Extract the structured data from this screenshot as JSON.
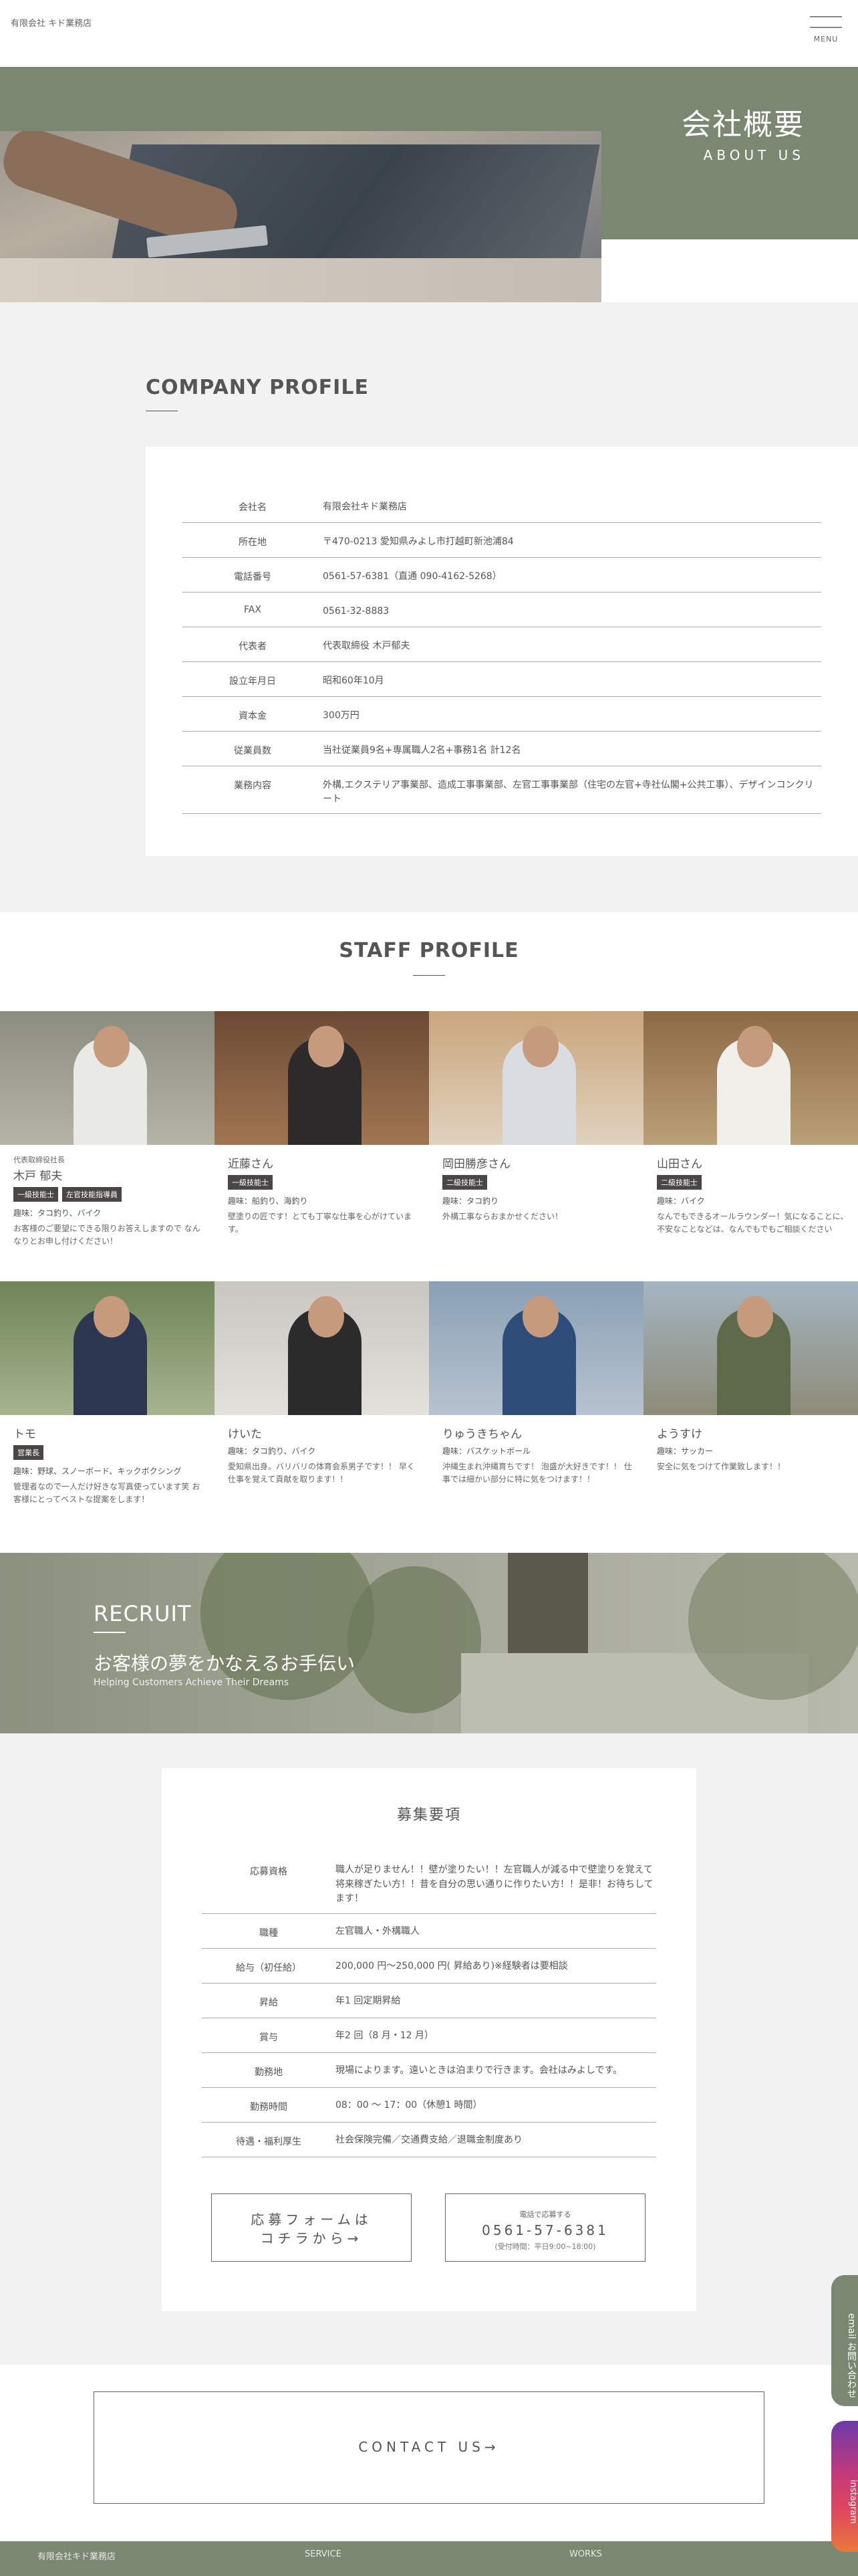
{
  "header": {
    "logo": "有限会社 キド業務店",
    "menu_label": "MENU"
  },
  "hero": {
    "title_jp": "会社概要",
    "title_en": "ABOUT US"
  },
  "company": {
    "heading": "COMPANY PROFILE",
    "rows": [
      {
        "k": "会社名",
        "v": "有限会社キド業務店"
      },
      {
        "k": "所在地",
        "v": "〒470-0213 愛知県みよし市打越町新池浦84"
      },
      {
        "k": "電話番号",
        "v": "0561-57-6381（直通 090-4162-5268）"
      },
      {
        "k": "FAX",
        "v": "0561-32-8883"
      },
      {
        "k": "代表者",
        "v": "代表取締役 木戸郁夫"
      },
      {
        "k": "設立年月日",
        "v": "昭和60年10月"
      },
      {
        "k": "資本金",
        "v": "300万円"
      },
      {
        "k": "従業員数",
        "v": "当社従業員9名+専属職人2名+事務1名 計12名"
      },
      {
        "k": "業務内容",
        "v": "外構,エクステリア事業部、造成工事事業部、左官工事事業部（住宅の左官+寺社仏閣+公共工事）、デザインコンクリート"
      }
    ]
  },
  "staff": {
    "heading": "STAFF PROFILE",
    "members": [
      {
        "title": "代表取締役社長",
        "name": "木戸 郁夫",
        "badges": [
          "一級技能士",
          "左官技能指導員"
        ],
        "hobby": "趣味：タコ釣り、バイク",
        "msg": "お客様のご要望にできる限りお答えしますので なんなりとお申し付けください！"
      },
      {
        "title": "",
        "name": "近藤さん",
        "badges": [
          "一級技能士"
        ],
        "hobby": "趣味：船釣り、海釣り",
        "msg": "壁塗りの匠です！とても丁寧な仕事を心がけています。"
      },
      {
        "title": "",
        "name": "岡田勝彦さん",
        "badges": [
          "二級技能士"
        ],
        "hobby": "趣味：タコ釣り",
        "msg": "外構工事ならおまかせください！"
      },
      {
        "title": "",
        "name": "山田さん",
        "badges": [
          "二級技能士"
        ],
        "hobby": "趣味：バイク",
        "msg": "なんでもできるオールラウンダー！気になることに、不安なことなどは、なんでもでもご相談ください"
      },
      {
        "title": "",
        "name": "トモ",
        "badges": [
          "営業長"
        ],
        "hobby": "趣味：野球、スノーボード、キックボクシング",
        "msg": "管理者なので一人だけ好きな写真使っています笑 お客様にとってベストな提案をします！"
      },
      {
        "title": "",
        "name": "けいた",
        "badges": [],
        "hobby": "趣味：タコ釣り、バイク",
        "msg": "愛知県出身。バリバリの体育会系男子です！！ 早く仕事を覚えて貢献を取ります！！"
      },
      {
        "title": "",
        "name": "りゅうきちゃん",
        "badges": [],
        "hobby": "趣味：バスケットボール",
        "msg": "沖縄生まれ沖縄育ちです！ 泡盛が大好きです！！ 仕事では細かい部分に特に気をつけます！！"
      },
      {
        "title": "",
        "name": "ようすけ",
        "badges": [],
        "hobby": "趣味：サッカー",
        "msg": "安全に気をつけて作業致します！！"
      }
    ]
  },
  "recruit_banner": {
    "en": "RECRUIT",
    "jp": "お客様の夢をかなえるお手伝い",
    "sub": "Helping Customers Achieve Their Dreams"
  },
  "recruit": {
    "title": "募集要項",
    "rows": [
      {
        "k": "応募資格",
        "v": "職人が足りません！！壁が塗りたい！！左官職人が減る中で壁塗りを覚えて将来稼ぎたい方！！昔を自分の思い通りに作りたい方！！是非！お待ちしてます！"
      },
      {
        "k": "職種",
        "v": "左官職人・外構職人"
      },
      {
        "k": "給与（初任給）",
        "v": "200,000 円〜250,000 円( 昇給あり)※経験者は要相談"
      },
      {
        "k": "昇給",
        "v": "年1 回定期昇給"
      },
      {
        "k": "賞与",
        "v": "年2 回（8 月・12 月）"
      },
      {
        "k": "勤務地",
        "v": "現場によります。遠いときは泊まりで行きます。会社はみよしです。"
      },
      {
        "k": "勤務時間",
        "v": "08：00 〜 17：00（休憩1 時間）"
      },
      {
        "k": "待遇・福利厚生",
        "v": "社会保険完備／交通費支給／退職金制度あり"
      }
    ],
    "apply_line1": "応募フォームは",
    "apply_line2": "コチラから→",
    "tel_label": "電話で応募する",
    "tel_number": "0561-57-6381",
    "tel_hours": "(受付時間：平日9:00~18:00)"
  },
  "contact": {
    "label": "CONTACT US→"
  },
  "side": {
    "email": "email お問い合わせ",
    "instagram": "instagram"
  },
  "footer": {
    "company": "有限会社キド業務店",
    "service": "SERVICE",
    "works": "WORKS"
  },
  "colors": {
    "accent_green": "#7a8771",
    "badge_dark": "#4b4646",
    "bg_gray": "#f2f2f2"
  }
}
